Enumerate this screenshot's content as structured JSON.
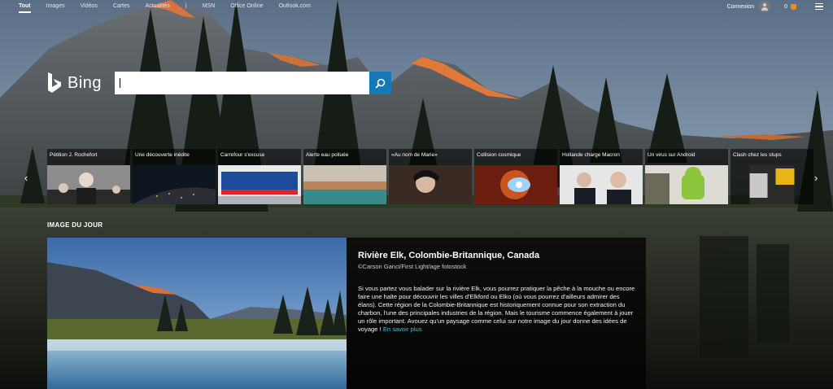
{
  "nav": {
    "links": [
      "Tout",
      "Images",
      "Vidéos",
      "Cartes",
      "Actualités",
      "|",
      "MSN",
      "Office Online",
      "Outlook.com"
    ],
    "active": "Tout"
  },
  "header_right": {
    "signin_label": "Connexion",
    "rewards_count": "0",
    "avatar_icon": "user-avatar-icon",
    "rewards_icon": "trophy-icon",
    "menu_icon": "hamburger-menu-icon"
  },
  "logo": {
    "text": "Bing"
  },
  "search": {
    "value": "",
    "placeholder": "",
    "button_icon": "search-icon"
  },
  "carousel": {
    "prev_arrow": "‹",
    "next_arrow": "›",
    "items": [
      {
        "title": "Pétition J. Rochefort"
      },
      {
        "title": "Une découverte inédite"
      },
      {
        "title": "Carrefour s'excuse"
      },
      {
        "title": "Alerte eau polluée"
      },
      {
        "title": "«Au nom de Marie»"
      },
      {
        "title": "Collision cosmique"
      },
      {
        "title": "Hollande charge Macron"
      },
      {
        "title": "Un virus sur Android"
      },
      {
        "title": "Clash chez les stups"
      }
    ]
  },
  "image_of_day": {
    "section_label": "IMAGE DU JOUR",
    "title": "Rivière Elk, Colombie-Britannique, Canada",
    "credit": "©Carson Ganci/First Light/age fotostock",
    "body": "Si vous partez vous balader sur la rivière Elk, vous pourrez pratiquer la pêche à la mouche ou encore faire une halte pour découvrir les villes d'Elkford ou Elko (où vous pourrez d'ailleurs admirer des élans). Cette région de la Colombie-Britannique est historiquement connue pour son extraction du charbon, l'une des principales industries de la région. Mais le tourisme commence également à jouer un rôle important. Avouez qu'un paysage comme celui sur notre image du jour donne des idées de voyage !",
    "more_link": "En savoir plus"
  },
  "colors": {
    "accent": "#1579b8",
    "link": "#43c0e8",
    "mountain_glow": "#e0783a"
  }
}
